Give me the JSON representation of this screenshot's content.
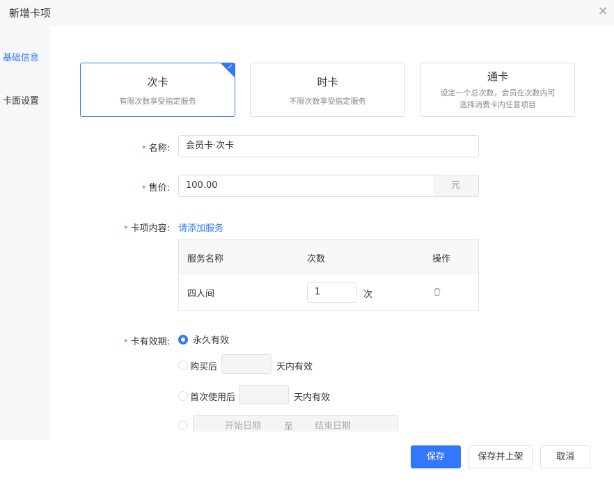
{
  "dialog": {
    "title": "新增卡项",
    "close_symbol": "×"
  },
  "sidebar": {
    "items": [
      {
        "label": "基础信息",
        "active": true
      },
      {
        "label": "卡面设置",
        "active": false
      }
    ]
  },
  "card_types": [
    {
      "title": "次卡",
      "desc_lines": [
        "有限次数享受指定服务"
      ],
      "selected": true
    },
    {
      "title": "时卡",
      "desc_lines": [
        "不限次数享受指定服务"
      ],
      "selected": false
    },
    {
      "title": "通卡",
      "desc_lines": [
        "设定一个总次数，会员在次数内可",
        "选择消费卡内任意项目"
      ],
      "selected": false
    }
  ],
  "form": {
    "required_mark": "*",
    "name": {
      "label": "名称:",
      "value": "会员卡·次卡"
    },
    "price": {
      "label": "售价:",
      "value": "100.00",
      "unit": "元"
    },
    "content": {
      "label": "卡项内容:",
      "add_link": "请添加服务"
    },
    "service_table": {
      "headers": [
        "服务名称",
        "次数",
        "操作"
      ],
      "rows": [
        {
          "name": "四人间",
          "count": "1",
          "unit": "次"
        }
      ]
    },
    "validity": {
      "label": "卡有效期:",
      "options": [
        {
          "label": "永久有效",
          "checked": true
        },
        {
          "prefix": "购买后",
          "suffix": "天内有效",
          "checked": false
        },
        {
          "prefix": "首次使用后",
          "suffix": "天内有效",
          "checked": false
        },
        {
          "start_placeholder": "开始日期",
          "separator": "至",
          "end_placeholder": "结束日期",
          "checked": false
        }
      ]
    }
  },
  "footer": {
    "save": "保存",
    "save_publish": "保存并上架",
    "cancel": "取消"
  },
  "colors": {
    "accent": "#3377ff",
    "required": "#e4393c",
    "panel_bg": "#f7f8fa"
  },
  "icons": {
    "selected": "check-icon",
    "delete": "trash-icon",
    "close": "close-icon"
  }
}
